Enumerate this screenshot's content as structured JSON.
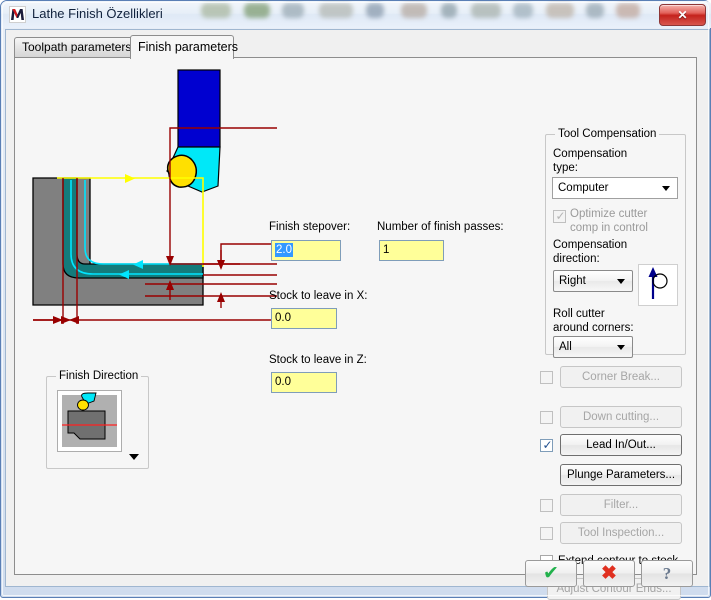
{
  "window": {
    "title": "Lathe Finish Özellikleri",
    "icon": "mastercam-logo-icon",
    "close_label": "✕"
  },
  "tabs": [
    {
      "label": "Toolpath parameters",
      "active": false
    },
    {
      "label": "Finish parameters",
      "active": true
    }
  ],
  "fields": {
    "finish_stepover": {
      "label": "Finish stepover:",
      "value": "2.0",
      "selected": true
    },
    "number_of_passes": {
      "label": "Number of finish passes:",
      "value": "1"
    },
    "stock_x": {
      "label": "Stock to leave in X:",
      "value": "0.0"
    },
    "stock_z": {
      "label": "Stock to leave in Z:",
      "value": "0.0"
    }
  },
  "finish_direction": {
    "group_label": "Finish Direction",
    "preview_icon": "lathe-finish-direction-preview",
    "dropdown_icon": "chevron-down-icon"
  },
  "tool_compensation": {
    "group_label": "Tool Compensation",
    "comp_type_label": "Compensation\ntype:",
    "comp_type_value": "Computer",
    "optimize_label": "Optimize cutter\n    comp in control",
    "optimize_checked": true,
    "optimize_disabled": true,
    "comp_direction_label": "Compensation\ndirection:",
    "comp_direction_value": "Right",
    "comp_direction_icon": "compensation-direction-arrow-icon",
    "roll_cutter_label": "Roll cutter\naround corners:",
    "roll_cutter_value": "All"
  },
  "options": [
    {
      "name": "corner-break",
      "label": "Corner Break...",
      "mnemonic": "C",
      "checkbox": true,
      "checked": false,
      "disabled": true
    },
    {
      "name": "down-cutting",
      "label": "Down cutting...",
      "mnemonic": "",
      "checkbox": true,
      "checked": false,
      "disabled": true
    },
    {
      "name": "lead-in-out",
      "label": "Lead In/Out...",
      "mnemonic": "L",
      "checkbox": true,
      "checked": true,
      "disabled": false
    },
    {
      "name": "plunge-parameters",
      "label": "Plunge Parameters...",
      "mnemonic": "P",
      "checkbox": false,
      "checked": false,
      "disabled": false
    },
    {
      "name": "filter",
      "label": "Filter...",
      "mnemonic": "",
      "checkbox": true,
      "checked": false,
      "disabled": true
    },
    {
      "name": "tool-inspection",
      "label": "Tool Inspection...",
      "mnemonic": "I",
      "checkbox": true,
      "checked": false,
      "disabled": true
    }
  ],
  "extend_contour": {
    "label": "Extend contour to stock",
    "checked": false
  },
  "adjust_contour_ends": {
    "label": "Adjust Contour Ends...",
    "mnemonic": "A",
    "disabled": true
  },
  "dialog_buttons": [
    {
      "name": "ok-button",
      "glyph": "✔",
      "color": "#22b14c"
    },
    {
      "name": "cancel-button",
      "glyph": "✖",
      "color": "#e03020"
    },
    {
      "name": "help-button",
      "glyph": "?",
      "color": "#6b7a8f"
    }
  ],
  "colors": {
    "stock": "#808080",
    "material": "#147b7b",
    "toolpath": "#00e5ff",
    "boundary": "#ffff00",
    "dimension": "#990000",
    "tool_shank": "#0000d0",
    "tool_holder": "#00e8f8",
    "tool_insert": "#ffe000"
  }
}
